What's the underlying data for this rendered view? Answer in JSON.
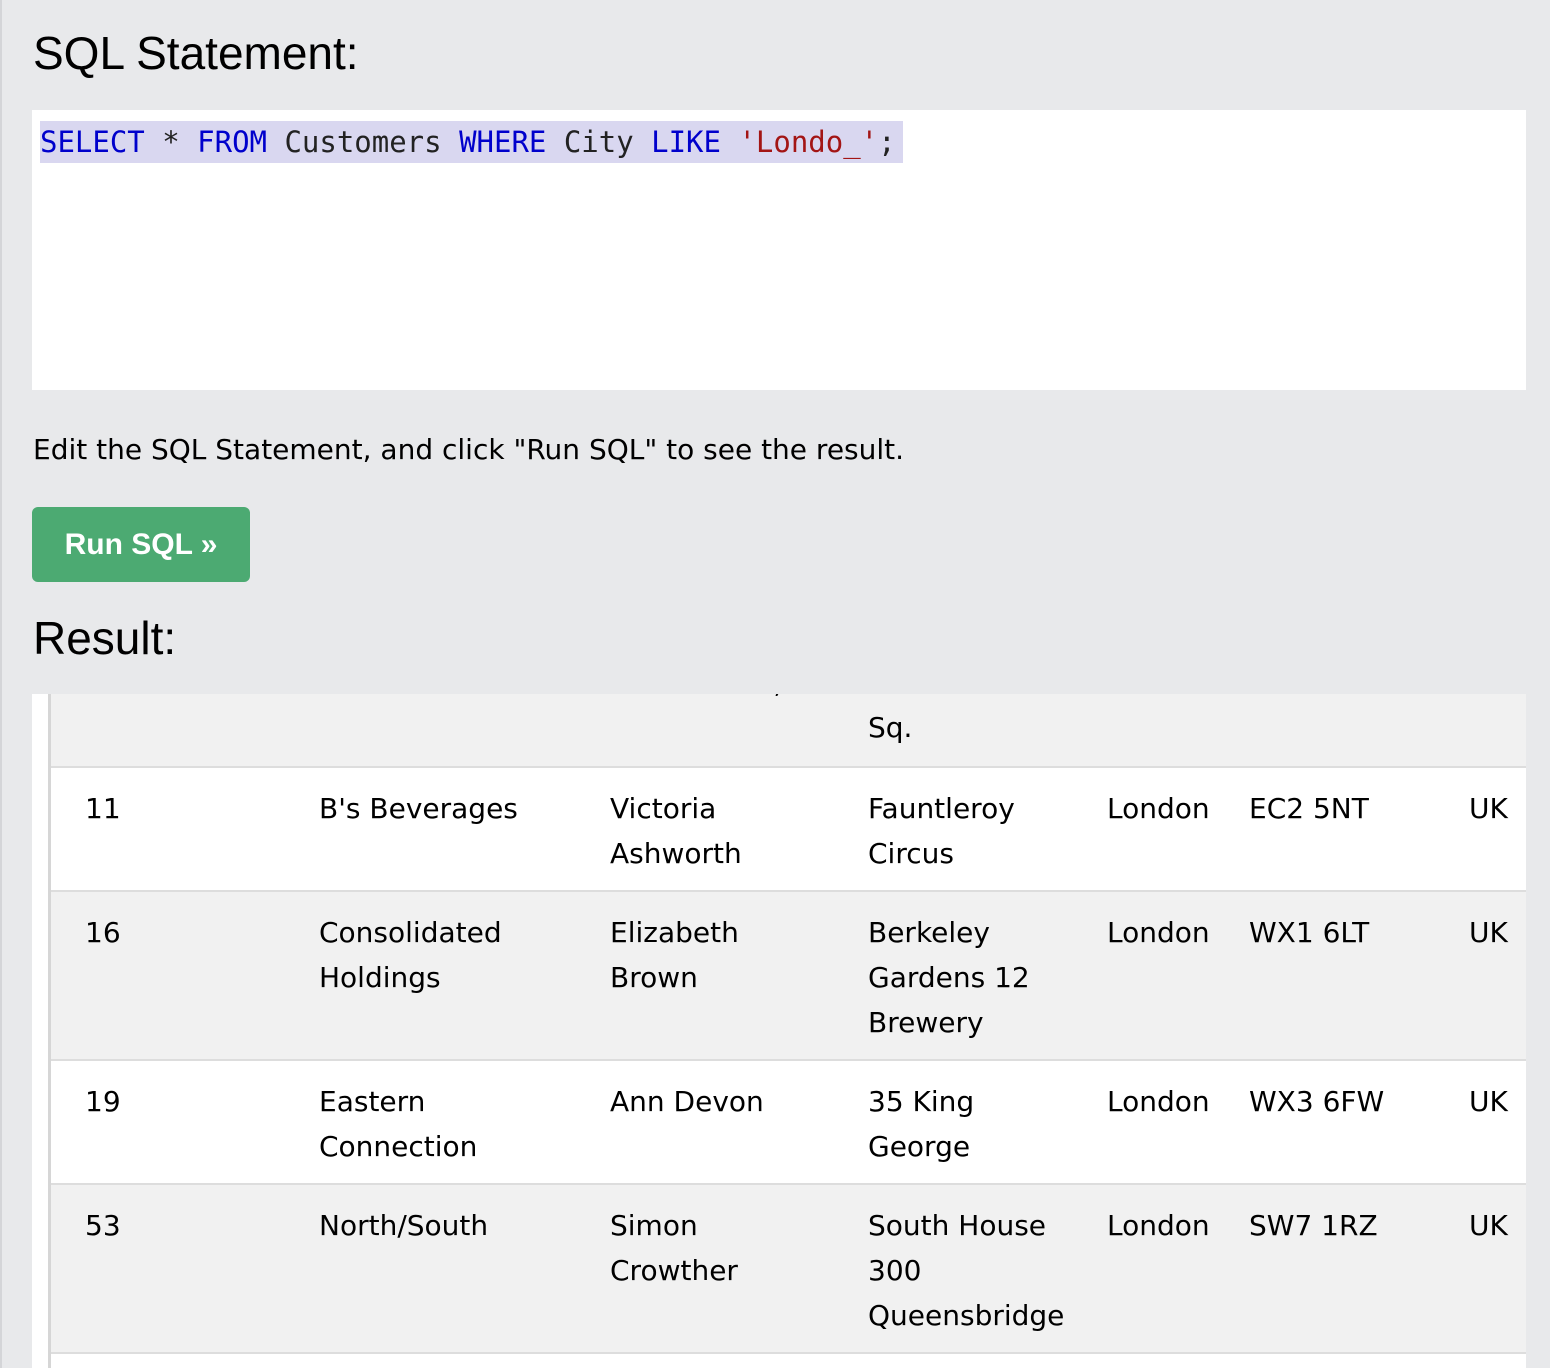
{
  "sql_heading": "SQL Statement:",
  "editor": {
    "kw_select": "SELECT",
    "star": " * ",
    "kw_from": "FROM",
    "table_name": " Customers ",
    "kw_where": "WHERE",
    "column_name": " City ",
    "kw_like": "LIKE",
    "space": " ",
    "pattern": "'Londo_'",
    "terminator": ";"
  },
  "instructions": "Edit the SQL Statement, and click \"Run SQL\" to see the result.",
  "run_button_label": "Run SQL »",
  "result_heading": "Result:",
  "result": {
    "partial_row": {
      "address_tail": "Sq."
    },
    "rows": [
      {
        "id": "11",
        "customer_name": "B's Beverages",
        "contact_name": "Victoria Ashworth",
        "address": "Fauntleroy Circus",
        "city": "London",
        "postal_code": "EC2 5NT",
        "country": "UK"
      },
      {
        "id": "16",
        "customer_name": "Consolidated Holdings",
        "contact_name": "Elizabeth Brown",
        "address": "Berkeley Gardens 12 Brewery",
        "city": "London",
        "postal_code": "WX1 6LT",
        "country": "UK"
      },
      {
        "id": "19",
        "customer_name": "Eastern Connection",
        "contact_name": "Ann Devon",
        "address": "35 King George",
        "city": "London",
        "postal_code": "WX3 6FW",
        "country": "UK"
      },
      {
        "id": "53",
        "customer_name": "North/South",
        "contact_name": "Simon Crowther",
        "address": "South House 300 Queensbridge",
        "city": "London",
        "postal_code": "SW7 1RZ",
        "country": "UK"
      }
    ]
  }
}
